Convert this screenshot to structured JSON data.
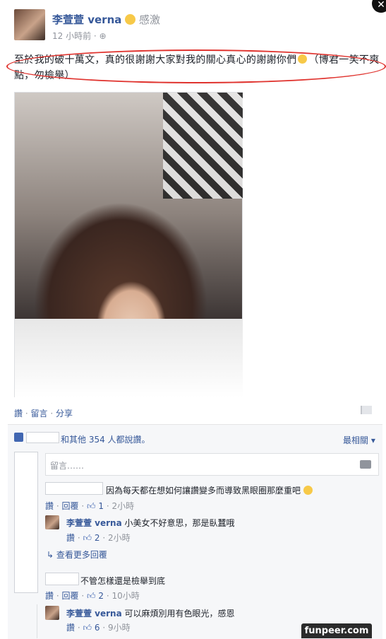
{
  "post": {
    "author": "李萱萱 verna",
    "feeling": "感激",
    "time": "12 小時前",
    "text": "至於我的破十萬文，真的很謝謝大家對我的關心真心的謝謝你們",
    "text_line2": "（博君一笑不爽點，勿檢舉）",
    "actions": {
      "like": "讚",
      "comment": "留言",
      "share": "分享"
    }
  },
  "likes": {
    "text": "和其他 354 人都說讚。",
    "sort": "最相關"
  },
  "comment_box": {
    "placeholder": "留言……"
  },
  "comments": [
    {
      "text": "因為每天都在想如何讓讚變多而導致黑眼圈那麼重吧",
      "actions": {
        "like": "讚",
        "reply": "回覆"
      },
      "likes": "1",
      "time": "2小時",
      "reply": {
        "author": "李萱萱 verna",
        "text": "小美女不好意思，那是臥蠶哦",
        "actions": {
          "like": "讚"
        },
        "likes": "2",
        "time": "2小時"
      },
      "more_replies": "查看更多回覆"
    },
    {
      "text": "不管怎樣還是檢舉到底",
      "actions": {
        "like": "讚",
        "reply": "回覆"
      },
      "likes": "2",
      "time": "10小時",
      "reply": {
        "author": "李萱萱 verna",
        "text": "可以麻煩別用有色眼光，感恩",
        "actions": {
          "like": "讚"
        },
        "likes": "6",
        "time": "9小時"
      }
    }
  ],
  "watermark": "funpeer.com",
  "colors": {
    "link": "#365899",
    "muted": "#90949c",
    "annotation": "#e0342f",
    "panel": "#f6f7f9"
  },
  "icons": [
    "globe-icon",
    "smiley-icon",
    "like-icon",
    "camera-icon",
    "reply-arrow-icon",
    "flag-icon",
    "dropdown-icon",
    "close-icon"
  ]
}
